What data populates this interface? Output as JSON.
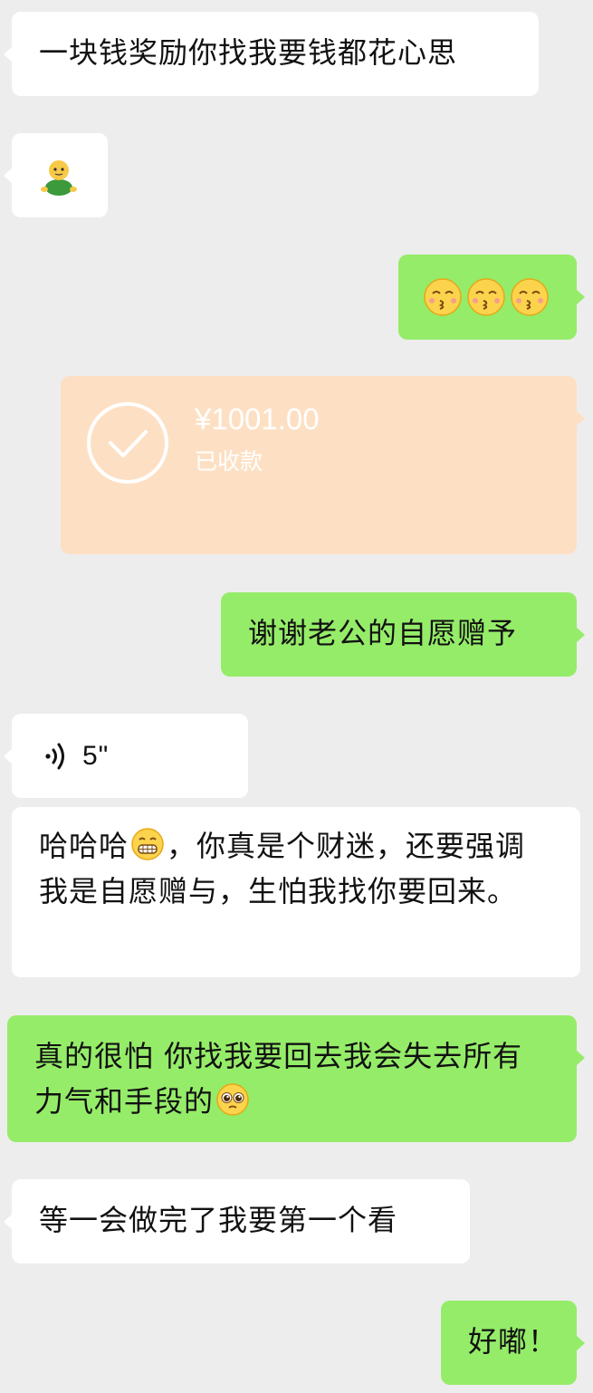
{
  "messages": {
    "m1": {
      "text": "一块钱奖励你找我要钱都花心思"
    },
    "m2": {
      "sticker": "person-sticker-icon"
    },
    "m3": {
      "emojis": [
        "kissing-smiling-eyes-emoji",
        "kissing-smiling-eyes-emoji",
        "kissing-smiling-eyes-emoji"
      ]
    },
    "m4": {
      "amount": "¥1001.00",
      "status": "已收款",
      "icon": "check-circle-icon"
    },
    "m5": {
      "text": "谢谢老公的自愿赠予"
    },
    "m6": {
      "duration": "5\"",
      "icon": "voice-wave-icon"
    },
    "m7": {
      "part1": "哈哈哈",
      "emoji": "grinning-emoji",
      "part2": "，你真是个财迷，还要强调我是自愿赠与，生怕我找你要回来。"
    },
    "m8": {
      "text": "真的很怕 你找我要回去我会失去所有力气和手段的",
      "emoji": "pleading-face-emoji"
    },
    "m9": {
      "text": "等一会做完了我要第一个看"
    },
    "m10": {
      "text": "好嘟！"
    }
  },
  "colors": {
    "background": "#ededed",
    "incoming_bubble": "#ffffff",
    "outgoing_bubble": "#95ec69",
    "transfer_card": "#fde0c4"
  }
}
